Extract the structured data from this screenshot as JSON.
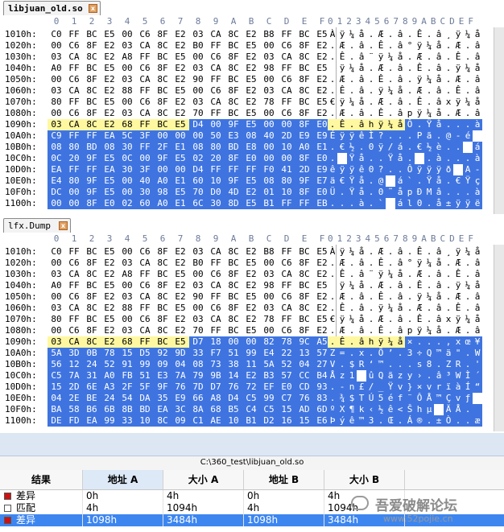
{
  "panes": [
    {
      "tab": "libjuan_old.so",
      "columns": [
        "0",
        "1",
        "2",
        "3",
        "4",
        "5",
        "6",
        "7",
        "8",
        "9",
        "A",
        "B",
        "C",
        "D",
        "E",
        "F"
      ],
      "ascii_header": "0123456789ABCDEF",
      "rows": [
        {
          "addr": "1010h:",
          "hex": [
            "C0",
            "FF",
            "BC",
            "E5",
            "00",
            "C6",
            "8F",
            "E2",
            "03",
            "CA",
            "8C",
            "E2",
            "B8",
            "FF",
            "BC",
            "E5"
          ],
          "ascii": "Àÿ¼å.Æ.â.Ê.â¸ÿ¼å",
          "sel_from": -1,
          "cur": false
        },
        {
          "addr": "1020h:",
          "hex": [
            "00",
            "C6",
            "8F",
            "E2",
            "03",
            "CA",
            "8C",
            "E2",
            "B0",
            "FF",
            "BC",
            "E5",
            "00",
            "C6",
            "8F",
            "E2"
          ],
          "ascii": ".Æ.â.Ê.â°ÿ¼å.Æ.â",
          "sel_from": -1,
          "cur": false
        },
        {
          "addr": "1030h:",
          "hex": [
            "03",
            "CA",
            "8C",
            "E2",
            "A8",
            "FF",
            "BC",
            "E5",
            "00",
            "C6",
            "8F",
            "E2",
            "03",
            "CA",
            "8C",
            "E2"
          ],
          "ascii": ".Ê.â¨ÿ¼å.Æ.â.Ê.â",
          "sel_from": -1,
          "cur": false
        },
        {
          "addr": "1040h:",
          "hex": [
            "A0",
            "FF",
            "BC",
            "E5",
            "00",
            "C6",
            "8F",
            "E2",
            "03",
            "CA",
            "8C",
            "E2",
            "98",
            "FF",
            "BC",
            "E5"
          ],
          "ascii": " ÿ¼å.Æ.â.Ê.â.ÿ¼å",
          "sel_from": -1,
          "cur": false
        },
        {
          "addr": "1050h:",
          "hex": [
            "00",
            "C6",
            "8F",
            "E2",
            "03",
            "CA",
            "8C",
            "E2",
            "90",
            "FF",
            "BC",
            "E5",
            "00",
            "C6",
            "8F",
            "E2"
          ],
          "ascii": ".Æ.â.Ê.â.ÿ¼å.Æ.â",
          "sel_from": -1,
          "cur": false
        },
        {
          "addr": "1060h:",
          "hex": [
            "03",
            "CA",
            "8C",
            "E2",
            "88",
            "FF",
            "BC",
            "E5",
            "00",
            "C6",
            "8F",
            "E2",
            "03",
            "CA",
            "8C",
            "E2"
          ],
          "ascii": ".Ê.â.ÿ¼å.Æ.â.Ê.â",
          "sel_from": -1,
          "cur": false
        },
        {
          "addr": "1070h:",
          "hex": [
            "80",
            "FF",
            "BC",
            "E5",
            "00",
            "C6",
            "8F",
            "E2",
            "03",
            "CA",
            "8C",
            "E2",
            "78",
            "FF",
            "BC",
            "E5"
          ],
          "ascii": "€ÿ¼å.Æ.â.Ê.âxÿ¼å",
          "sel_from": -1,
          "cur": false
        },
        {
          "addr": "1080h:",
          "hex": [
            "00",
            "C6",
            "8F",
            "E2",
            "03",
            "CA",
            "8C",
            "E2",
            "70",
            "FF",
            "BC",
            "E5",
            "00",
            "C6",
            "8F",
            "E2"
          ],
          "ascii": ".Æ.â.Ê.âpÿ¼å.Æ.â",
          "sel_from": -1,
          "cur": false
        },
        {
          "addr": "1090h:",
          "hex": [
            "03",
            "CA",
            "8C",
            "E2",
            "68",
            "FF",
            "BC",
            "E5",
            "D4",
            "00",
            "9F",
            "E5",
            "00",
            "00",
            "8F",
            "E0"
          ],
          "ascii": ".Ê.âhÿ¼åÔ.Ÿå...à",
          "sel_from": 8,
          "cur": true
        },
        {
          "addr": "10A0h:",
          "hex": [
            "C9",
            "FF",
            "FF",
            "EA",
            "5C",
            "3F",
            "00",
            "00",
            "00",
            "50",
            "E3",
            "08",
            "40",
            "2D",
            "E9",
            "E9"
          ],
          "ascii": "ÉÿÿêÌ?...Pã.@-é",
          "sel_from": 0,
          "cur": false
        },
        {
          "addr": "10B0h:",
          "hex": [
            "08",
            "80",
            "BD",
            "08",
            "30",
            "FF",
            "2F",
            "E1",
            "08",
            "80",
            "BD",
            "E8",
            "00",
            "10",
            "A0",
            "E1"
          ],
          "ascii": ".€½.0ÿ/á.€½è.. á",
          "sel_from": 0,
          "cur": false
        },
        {
          "addr": "10C0h:",
          "hex": [
            "0C",
            "20",
            "9F",
            "E5",
            "0C",
            "00",
            "9F",
            "E5",
            "02",
            "20",
            "8F",
            "E0",
            "00",
            "00",
            "8F",
            "E0"
          ],
          "ascii": ". Ÿå..Ÿå. .à...à",
          "sel_from": 0,
          "cur": false
        },
        {
          "addr": "10D0h:",
          "hex": [
            "EA",
            "FF",
            "FF",
            "EA",
            "30",
            "3F",
            "00",
            "00",
            "D4",
            "FF",
            "FF",
            "FF",
            "F0",
            "41",
            "2D",
            "E9"
          ],
          "ascii": "êÿÿê0?..Ôÿÿÿð A-é",
          "sel_from": 0,
          "cur": false
        },
        {
          "addr": "10E0h:",
          "hex": [
            "E4",
            "80",
            "9F",
            "E5",
            "00",
            "40",
            "A0",
            "E1",
            "60",
            "10",
            "9F",
            "E5",
            "08",
            "80",
            "9F",
            "E7"
          ],
          "ascii": "ä€Ÿå.@ á`.Ÿå.€Ÿç",
          "sel_from": 0,
          "cur": false
        },
        {
          "addr": "10F0h:",
          "hex": [
            "DC",
            "00",
            "9F",
            "E5",
            "00",
            "30",
            "98",
            "E5",
            "70",
            "D0",
            "4D",
            "E2",
            "01",
            "10",
            "8F",
            "E0"
          ],
          "ascii": "Ü.Ÿå.0˜åpÐMâ...à",
          "sel_from": 0,
          "cur": false
        },
        {
          "addr": "1100h:",
          "hex": [
            "00",
            "00",
            "8F",
            "E0",
            "02",
            "60",
            "A0",
            "E1",
            "6C",
            "30",
            "8D",
            "E5",
            "B1",
            "FF",
            "FF",
            "EB"
          ],
          "ascii": "...à.` ál0.å±ÿÿë",
          "sel_from": 0,
          "cur": false
        }
      ]
    },
    {
      "tab": "lfx.Dump",
      "columns": [
        "0",
        "1",
        "2",
        "3",
        "4",
        "5",
        "6",
        "7",
        "8",
        "9",
        "A",
        "B",
        "C",
        "D",
        "E",
        "F"
      ],
      "ascii_header": "0123456789ABCDEF",
      "rows": [
        {
          "addr": "1010h:",
          "hex": [
            "C0",
            "FF",
            "BC",
            "E5",
            "00",
            "C6",
            "8F",
            "E2",
            "03",
            "CA",
            "8C",
            "E2",
            "B8",
            "FF",
            "BC",
            "E5"
          ],
          "ascii": "Àÿ¼å.Æ.â.Ê.â¸ÿ¼å",
          "sel_from": -1,
          "cur": false
        },
        {
          "addr": "1020h:",
          "hex": [
            "00",
            "C6",
            "8F",
            "E2",
            "03",
            "CA",
            "8C",
            "E2",
            "B0",
            "FF",
            "BC",
            "E5",
            "00",
            "C6",
            "8F",
            "E2"
          ],
          "ascii": ".Æ.â.Ê.â°ÿ¼å.Æ.â",
          "sel_from": -1,
          "cur": false
        },
        {
          "addr": "1030h:",
          "hex": [
            "03",
            "CA",
            "8C",
            "E2",
            "A8",
            "FF",
            "BC",
            "E5",
            "00",
            "C6",
            "8F",
            "E2",
            "03",
            "CA",
            "8C",
            "E2"
          ],
          "ascii": ".Ê.â¨ÿ¼å.Æ.â.Ê.â",
          "sel_from": -1,
          "cur": false
        },
        {
          "addr": "1040h:",
          "hex": [
            "A0",
            "FF",
            "BC",
            "E5",
            "00",
            "C6",
            "8F",
            "E2",
            "03",
            "CA",
            "8C",
            "E2",
            "98",
            "FF",
            "BC",
            "E5"
          ],
          "ascii": " ÿ¼å.Æ.â.Ê.â.ÿ¼å",
          "sel_from": -1,
          "cur": false
        },
        {
          "addr": "1050h:",
          "hex": [
            "00",
            "C6",
            "8F",
            "E2",
            "03",
            "CA",
            "8C",
            "E2",
            "90",
            "FF",
            "BC",
            "E5",
            "00",
            "C6",
            "8F",
            "E2"
          ],
          "ascii": ".Æ.â.Ê.â.ÿ¼å.Æ.â",
          "sel_from": -1,
          "cur": false
        },
        {
          "addr": "1060h:",
          "hex": [
            "03",
            "CA",
            "8C",
            "E2",
            "88",
            "FF",
            "BC",
            "E5",
            "00",
            "C6",
            "8F",
            "E2",
            "03",
            "CA",
            "8C",
            "E2"
          ],
          "ascii": ".Ê.â.ÿ¼å.Æ.â.Ê.â",
          "sel_from": -1,
          "cur": false
        },
        {
          "addr": "1070h:",
          "hex": [
            "80",
            "FF",
            "BC",
            "E5",
            "00",
            "C6",
            "8F",
            "E2",
            "03",
            "CA",
            "8C",
            "E2",
            "78",
            "FF",
            "BC",
            "E5"
          ],
          "ascii": "€ÿ¼å.Æ.â.Ê.âxÿ¼å",
          "sel_from": -1,
          "cur": false
        },
        {
          "addr": "1080h:",
          "hex": [
            "00",
            "C6",
            "8F",
            "E2",
            "03",
            "CA",
            "8C",
            "E2",
            "70",
            "FF",
            "BC",
            "E5",
            "00",
            "C6",
            "8F",
            "E2"
          ],
          "ascii": ".Æ.â.Ê.âpÿ¼å.Æ.â",
          "sel_from": -1,
          "cur": false
        },
        {
          "addr": "1090h:",
          "hex": [
            "03",
            "CA",
            "8C",
            "E2",
            "68",
            "FF",
            "BC",
            "E5",
            "D7",
            "18",
            "00",
            "00",
            "82",
            "78",
            "9C",
            "A5"
          ],
          "ascii": ".Ê.âhÿ¼å×...‚xœ¥",
          "sel_from": 8,
          "cur": true
        },
        {
          "addr": "10A0h:",
          "hex": [
            "5A",
            "3D",
            "0B",
            "78",
            "15",
            "D5",
            "92",
            "9D",
            "33",
            "F7",
            "51",
            "99",
            "E4",
            "22",
            "13",
            "57"
          ],
          "ascii": "Z=.x.Õ’.3÷Q™ä\".W",
          "sel_from": 0,
          "cur": false
        },
        {
          "addr": "10B0h:",
          "hex": [
            "56",
            "12",
            "24",
            "52",
            "91",
            "99",
            "09",
            "04",
            "08",
            "73",
            "38",
            "11",
            "5A",
            "52",
            "04",
            "27"
          ],
          "ascii": "V.$R‘™...s8.ZR.'",
          "sel_from": 0,
          "cur": false
        },
        {
          "addr": "10C0h:",
          "hex": [
            "C5",
            "7A",
            "31",
            "A0",
            "FB",
            "51",
            "E3",
            "7A",
            "79",
            "9B",
            "14",
            "E2",
            "B3",
            "57",
            "CC",
            "B4"
          ],
          "ascii": "Åz1 ûQãzy›.â³WÌ´",
          "sel_from": 0,
          "cur": false
        },
        {
          "addr": "10D0h:",
          "hex": [
            "15",
            "2D",
            "6E",
            "A3",
            "2F",
            "5F",
            "9F",
            "76",
            "7D",
            "D7",
            "76",
            "72",
            "EF",
            "E0",
            "CD",
            "93"
          ],
          "ascii": ".-n£/_Ÿv}×vrïàÍ“",
          "sel_from": 0,
          "cur": false
        },
        {
          "addr": "10E0h:",
          "hex": [
            "04",
            "2E",
            "BE",
            "24",
            "54",
            "DA",
            "35",
            "E9",
            "66",
            "A8",
            "D4",
            "C5",
            "99",
            "C7",
            "76",
            "83"
          ],
          "ascii": ".¾$TÚ5éf¨ÔÅ™Çvƒ",
          "sel_from": 0,
          "cur": false
        },
        {
          "addr": "10F0h:",
          "hex": [
            "BA",
            "58",
            "B6",
            "6B",
            "8B",
            "BD",
            "EA",
            "3C",
            "8A",
            "68",
            "B5",
            "C4",
            "C5",
            "15",
            "AD",
            "6D"
          ],
          "ascii": "ºX¶k‹½ê<Šhµ ÄÅ.­m",
          "sel_from": 0,
          "cur": false
        },
        {
          "addr": "1100h:",
          "hex": [
            "DE",
            "FD",
            "EA",
            "99",
            "33",
            "10",
            "8C",
            "09",
            "C1",
            "AE",
            "10",
            "B1",
            "D2",
            "16",
            "15",
            "E6"
          ],
          "ascii": "Þýê™3.Œ.Á®.±Ò..æ",
          "sel_from": 0,
          "cur": false
        }
      ]
    }
  ],
  "path": "C:\\360_test\\libjuan_old.so",
  "compare_table": {
    "headers": [
      "结果",
      "地址 A",
      "大小 A",
      "地址 B",
      "大小 B"
    ],
    "rows": [
      {
        "result": "差异",
        "addr_a": "0h",
        "size_a": "4h",
        "addr_b": "0h",
        "size_b": "4h",
        "marker_color": "#d01010",
        "selected": false
      },
      {
        "result": "匹配",
        "addr_a": "4h",
        "size_a": "1094h",
        "addr_b": "4h",
        "size_b": "1094h",
        "marker_color": "#ffffff",
        "selected": false
      },
      {
        "result": "差异",
        "addr_a": "1098h",
        "size_a": "3484h",
        "addr_b": "1098h",
        "size_b": "3484h",
        "marker_color": "#d01010",
        "selected": true
      }
    ]
  },
  "watermark": {
    "title": "吾爱破解论坛",
    "url": "www.52pojie.cn"
  },
  "colors": {
    "selection": "#3f74e0",
    "cursor_row": "#fff8a0",
    "diff_marker": "#d01010",
    "table_selection": "#3d86f0"
  }
}
